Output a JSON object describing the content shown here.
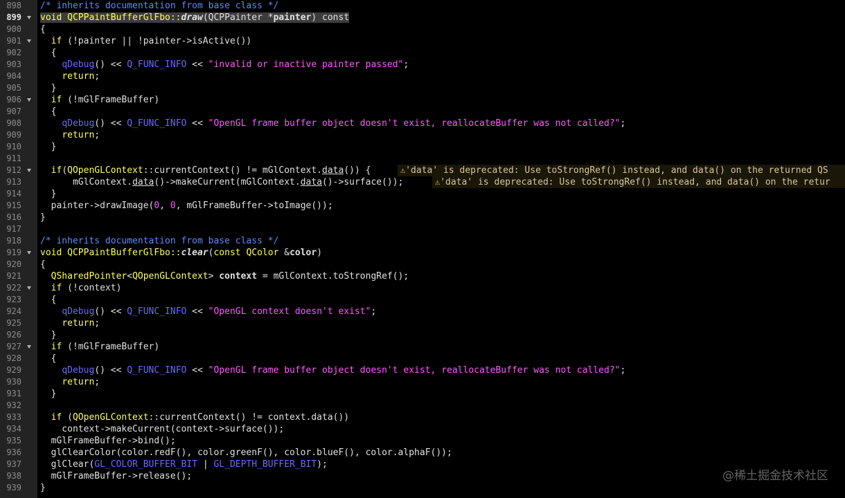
{
  "gutter": {
    "lines": [
      {
        "n": "898",
        "fold": false
      },
      {
        "n": "899",
        "fold": true
      },
      {
        "n": "900",
        "fold": false
      },
      {
        "n": "901",
        "fold": true
      },
      {
        "n": "902",
        "fold": false
      },
      {
        "n": "903",
        "fold": false
      },
      {
        "n": "904",
        "fold": false
      },
      {
        "n": "905",
        "fold": false
      },
      {
        "n": "906",
        "fold": true
      },
      {
        "n": "907",
        "fold": false
      },
      {
        "n": "908",
        "fold": false
      },
      {
        "n": "909",
        "fold": false
      },
      {
        "n": "910",
        "fold": false
      },
      {
        "n": "911",
        "fold": false
      },
      {
        "n": "912",
        "fold": true
      },
      {
        "n": "913",
        "fold": false
      },
      {
        "n": "914",
        "fold": false
      },
      {
        "n": "915",
        "fold": false
      },
      {
        "n": "916",
        "fold": false
      },
      {
        "n": "917",
        "fold": false
      },
      {
        "n": "918",
        "fold": false
      },
      {
        "n": "919",
        "fold": true
      },
      {
        "n": "920",
        "fold": false
      },
      {
        "n": "921",
        "fold": false
      },
      {
        "n": "922",
        "fold": true
      },
      {
        "n": "923",
        "fold": false
      },
      {
        "n": "924",
        "fold": false
      },
      {
        "n": "925",
        "fold": false
      },
      {
        "n": "926",
        "fold": false
      },
      {
        "n": "927",
        "fold": true
      },
      {
        "n": "928",
        "fold": false
      },
      {
        "n": "929",
        "fold": false
      },
      {
        "n": "930",
        "fold": false
      },
      {
        "n": "931",
        "fold": false
      },
      {
        "n": "932",
        "fold": false
      },
      {
        "n": "933",
        "fold": false
      },
      {
        "n": "934",
        "fold": false
      },
      {
        "n": "935",
        "fold": false
      },
      {
        "n": "936",
        "fold": false
      },
      {
        "n": "937",
        "fold": false
      },
      {
        "n": "938",
        "fold": false
      },
      {
        "n": "939",
        "fold": false
      }
    ],
    "current": "899"
  },
  "code": {
    "l898": "/* inherits documentation from base class */",
    "l899": {
      "a": "void ",
      "b": "QCPPaintBufferGlFbo::",
      "c": "draw",
      "d": "(QCPPainter *",
      "e": "painter",
      ",f": ") const"
    },
    "l899_f": ") const",
    "l900": "{",
    "l901": {
      "indent": "  ",
      "kw": "if",
      " rest": " (!painter || !painter->isActive())"
    },
    "l901_rest": " (!painter || !painter->isActive())",
    "l902": "  {",
    "l903": {
      "indent": "    ",
      "fn": "qDebug",
      "mid": "() << ",
      "mac": "Q_FUNC_INFO",
      "mid2": " << ",
      "str": "\"invalid or inactive painter passed\"",
      "end": ";"
    },
    "l904": {
      "indent": "    ",
      "kw": "return",
      "end": ";"
    },
    "l905": "  }",
    "l906": {
      "indent": "  ",
      "kw": "if",
      "rest": " (!mGlFrameBuffer)"
    },
    "l907": "  {",
    "l908": {
      "indent": "    ",
      "fn": "qDebug",
      "mid": "() << ",
      "mac": "Q_FUNC_INFO",
      "mid2": " << ",
      "str": "\"OpenGL frame buffer object doesn't exist, reallocateBuffer was not called?\"",
      "end": ";"
    },
    "l909": {
      "indent": "    ",
      "kw": "return",
      "end": ";"
    },
    "l910": "  }",
    "l911": "",
    "l912": {
      "indent": "  ",
      "kw": "if",
      "a": "(",
      "typ": "QOpenGLContext",
      "b": "::currentContext() != mGlContext.",
      "u": "data",
      "c": "()) {"
    },
    "l913": {
      "indent": "      ",
      "a": "mGlContext.",
      "u1": "data",
      "b": "()->makeCurrent(mGlContext.",
      "u2": "data",
      "c": "()->surface());"
    },
    "l914": "  }",
    "l915": {
      "indent": "  ",
      "a": "painter->drawImage(",
      "n1": "0",
      ",b": ", ",
      "n2": "0",
      "c": ", mGlFrameBuffer->toImage());"
    },
    "l915_b": ", ",
    "l916": "}",
    "l917": "",
    "l918": "/* inherits documentation from base class */",
    "l919": {
      "kw": "void",
      "a": " ",
      "cls": "QCPPaintBufferGlFbo::",
      "fn": "clear",
      "b": "(",
      "kw2": "const",
      "sp": " ",
      "typ": "QColor",
      "c": " &",
      "param": "color",
      "d": ")"
    },
    "l920": "{",
    "l921": {
      "indent": "  ",
      "typ": "QSharedPointer",
      "lt": "<",
      "typ2": "QOpenGLContext",
      "gt": "> ",
      "param": "context",
      "rest": " = mGlContext.toStrongRef();"
    },
    "l922": {
      "indent": "  ",
      "kw": "if",
      "rest": " (!context)"
    },
    "l923": "  {",
    "l924": {
      "indent": "    ",
      "fn": "qDebug",
      "mid": "() << ",
      "mac": "Q_FUNC_INFO",
      "mid2": " << ",
      "str": "\"OpenGL context doesn't exist\"",
      "end": ";"
    },
    "l925": {
      "indent": "    ",
      "kw": "return",
      "end": ";"
    },
    "l926": "  }",
    "l927": {
      "indent": "  ",
      "kw": "if",
      "rest": " (!mGlFrameBuffer)"
    },
    "l928": "  {",
    "l929": {
      "indent": "    ",
      "fn": "qDebug",
      "mid": "() << ",
      "mac": "Q_FUNC_INFO",
      "mid2": " << ",
      "str": "\"OpenGL frame buffer object doesn't exist, reallocateBuffer was not called?\"",
      "end": ";"
    },
    "l930": {
      "indent": "    ",
      "kw": "return",
      "end": ";"
    },
    "l931": "  }",
    "l932": "",
    "l933": {
      "indent": "  ",
      "kw": "if",
      "a": " (",
      "typ": "QOpenGLContext",
      "b": "::currentContext() != context.data())"
    },
    "l934": "    context->makeCurrent(context->surface());",
    "l935": "  mGlFrameBuffer->bind();",
    "l936": "  glClearColor(color.redF(), color.greenF(), color.blueF(), color.alphaF());",
    "l937": {
      "indent": "  ",
      "a": "glClear(",
      "m1": "GL_COLOR_BUFFER_BIT",
      "b": " | ",
      "m2": "GL_DEPTH_BUFFER_BIT",
      "c": ");"
    },
    "l938": "  mGlFrameBuffer->release();",
    "l939": "}"
  },
  "warnings": {
    "w912": "'data' is deprecated: Use toStrongRef() instead, and data() on the returned QS",
    "w913": "'data' is deprecated: Use toStrongRef() instead, and data() on the retur"
  },
  "watermark": "@稀土掘金技术社区",
  "colors": {
    "background": "#000000",
    "gutter": "#232323",
    "keyword": "#ffff5a",
    "comment": "#5a8cff",
    "string": "#ff5aff",
    "macro": "#6a6aff"
  }
}
